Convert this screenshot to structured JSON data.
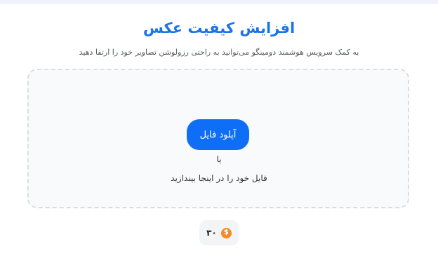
{
  "header": {
    "title": "افزایش کیفیت عکس",
    "subtitle": "به کمک سرویس هوشمند دومینگو می‌توانید به راحتی رزولوشن تصاویر خود را ارتقا دهید"
  },
  "upload": {
    "button_label": "آپلود فایل",
    "or_text": "یا",
    "drop_text": "فایل خود را در اینجا بیندازید"
  },
  "credits": {
    "value": "۳۰",
    "icon": "coin-dollar-icon",
    "icon_glyph": "$",
    "icon_color": "#f28b2a"
  },
  "colors": {
    "accent": "#1a73e8",
    "button": "#0e6ff6"
  }
}
